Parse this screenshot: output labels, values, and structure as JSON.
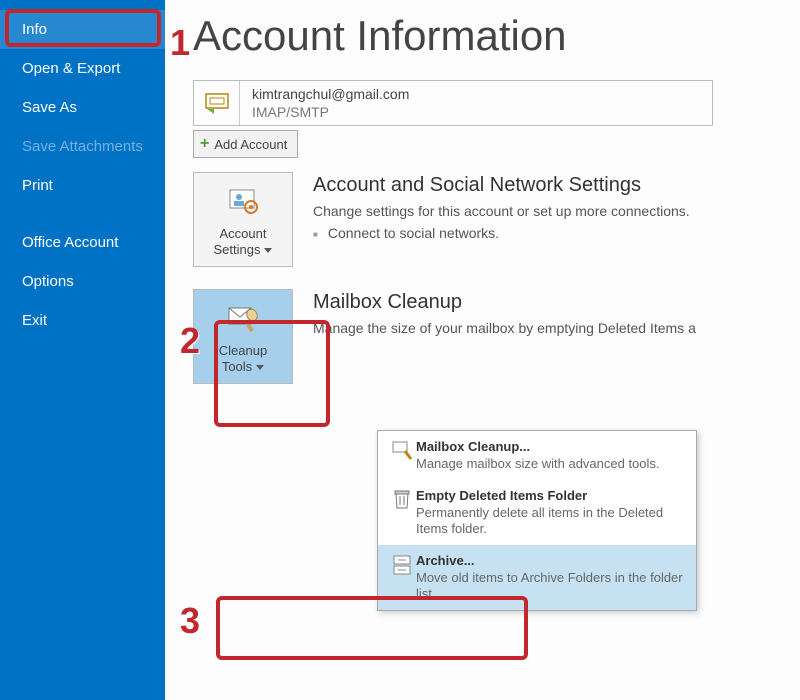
{
  "sidebar": {
    "items": [
      {
        "label": "Info"
      },
      {
        "label": "Open & Export"
      },
      {
        "label": "Save As"
      },
      {
        "label": "Save Attachments"
      },
      {
        "label": "Print"
      },
      {
        "label": "Office Account"
      },
      {
        "label": "Options"
      },
      {
        "label": "Exit"
      }
    ]
  },
  "main": {
    "title": "Account Information",
    "account": {
      "email": "kimtrangchul@gmail.com",
      "protocol": "IMAP/SMTP"
    },
    "add_account_label": "Add Account",
    "sections": {
      "settings": {
        "button_label_line1": "Account",
        "button_label_line2": "Settings",
        "heading": "Account and Social Network Settings",
        "desc": "Change settings for this account or set up more connections.",
        "bullet": "Connect to social networks."
      },
      "cleanup": {
        "button_label_line1": "Cleanup",
        "button_label_line2": "Tools",
        "heading": "Mailbox Cleanup",
        "desc": "Manage the size of your mailbox by emptying Deleted Items a"
      }
    },
    "dropdown": [
      {
        "title": "Mailbox Cleanup...",
        "desc": "Manage mailbox size with advanced tools."
      },
      {
        "title": "Empty Deleted Items Folder",
        "desc": "Permanently delete all items in the Deleted Items folder."
      },
      {
        "title": "Archive...",
        "desc": "Move old items to Archive Folders in the folder list."
      }
    ]
  },
  "annotations": {
    "n1": "1",
    "n2": "2",
    "n3": "3"
  }
}
